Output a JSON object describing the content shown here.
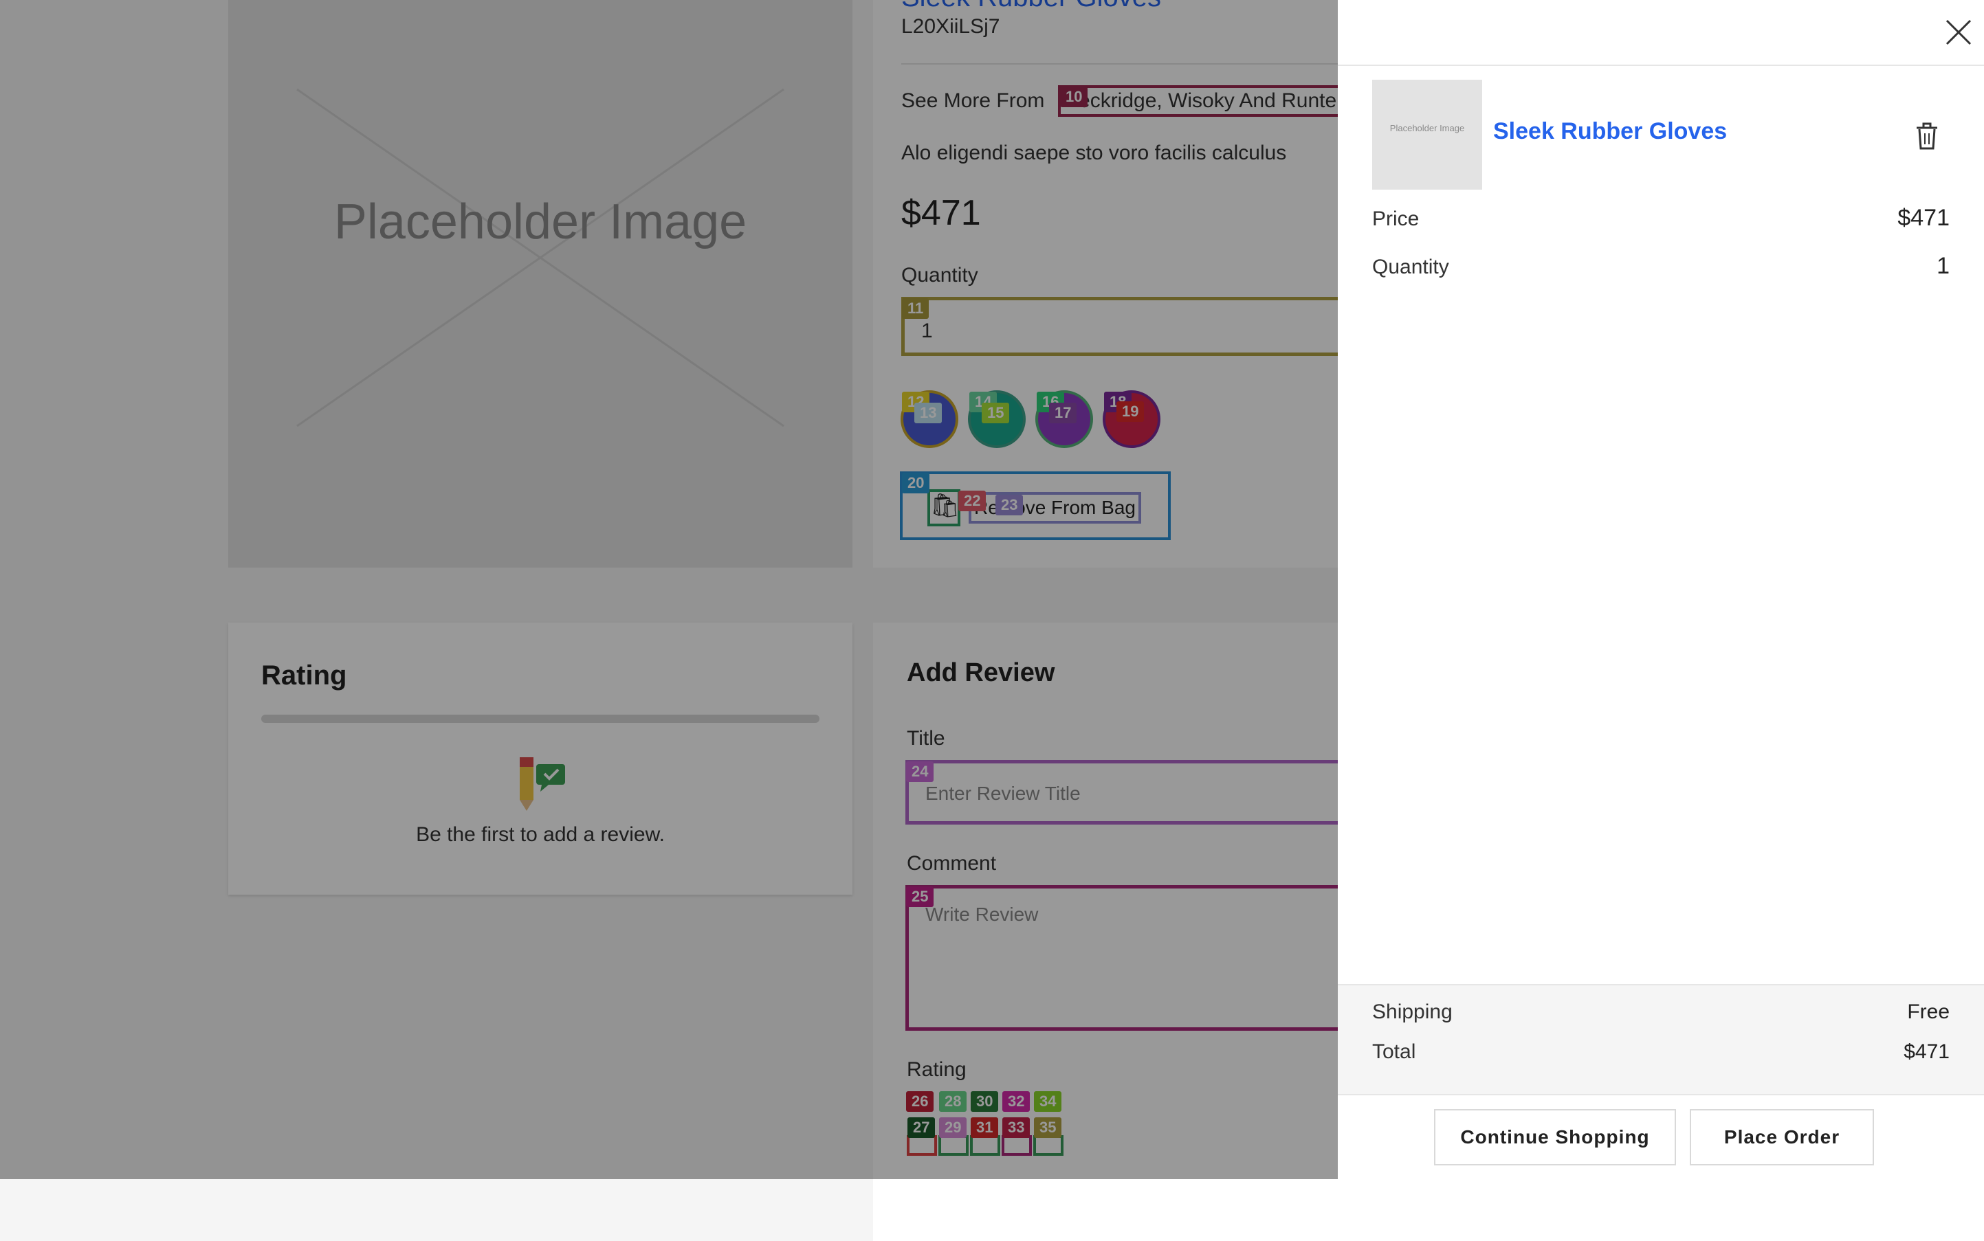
{
  "product": {
    "title": "Sleek Rubber Gloves",
    "sku": "L20XiiLSj7",
    "see_more_prefix": "See More From",
    "brand": "Beckridge, Wisoky And Runte",
    "description": "Alo eligendi saepe sto voro facilis calculus",
    "price": "$471",
    "quantity_label": "Quantity",
    "quantity_value": "1",
    "image_placeholder": "Placeholder Image",
    "remove_from_bag_label": "Remove From Bag",
    "swatch_colors": [
      "#4a5bd0",
      "#1aa88f",
      "#8a3cc0",
      "#d4234b"
    ]
  },
  "rating_section": {
    "heading": "Rating",
    "empty_text": "Be the first to add a review."
  },
  "review_section": {
    "heading": "Add Review",
    "title_label": "Title",
    "title_placeholder": "Enter Review Title",
    "comment_label": "Comment",
    "comment_placeholder": "Write Review",
    "rating_label": "Rating"
  },
  "badges": [
    "10",
    "11",
    "12",
    "13",
    "14",
    "15",
    "16",
    "17",
    "18",
    "19",
    "20",
    "22",
    "23",
    "24",
    "25",
    "26",
    "27",
    "28",
    "29",
    "30",
    "31",
    "32",
    "33",
    "34",
    "35"
  ],
  "cart_drawer": {
    "item": {
      "name": "Sleek Rubber Gloves",
      "thumb_placeholder": "Placeholder Image",
      "price_label": "Price",
      "price_value": "$471",
      "quantity_label": "Quantity",
      "quantity_value": "1"
    },
    "summary": {
      "shipping_label": "Shipping",
      "shipping_value": "Free",
      "total_label": "Total",
      "total_value": "$471"
    },
    "continue_label": "Continue Shopping",
    "place_order_label": "Place Order"
  },
  "colors": {
    "link_blue": "#2563eb",
    "overlay": "rgba(0,0,0,0.40)"
  }
}
